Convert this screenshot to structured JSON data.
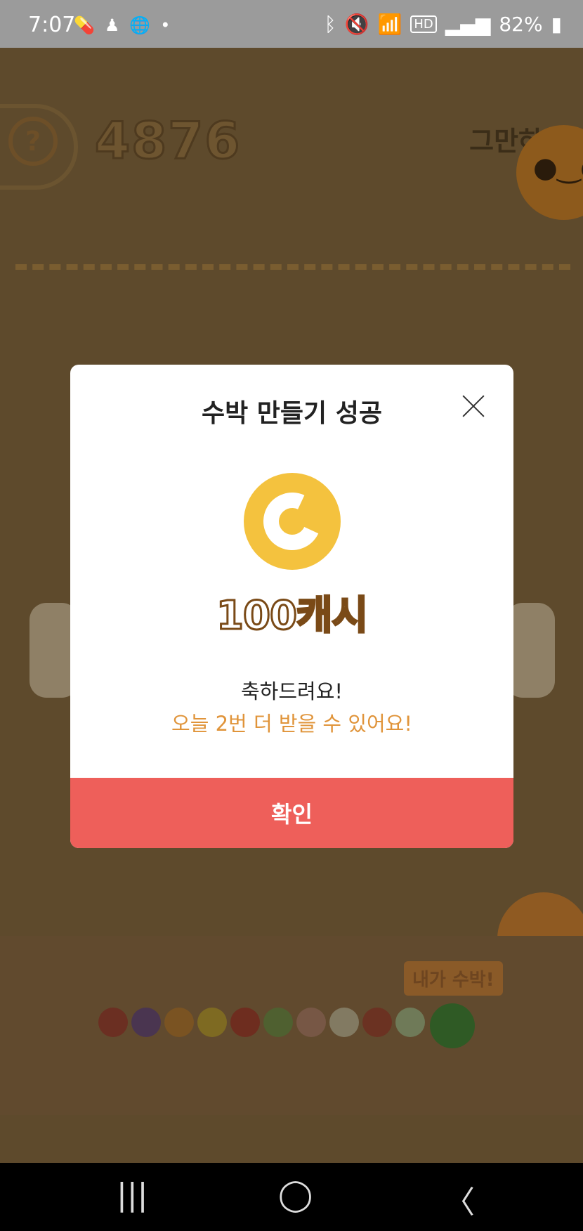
{
  "status_bar": {
    "time": "7:07",
    "battery": "82%",
    "left_icons": [
      "pill-icon",
      "person-icon",
      "globe-icon",
      "dot-icon"
    ],
    "right_icons": [
      "bluetooth-icon",
      "mute-icon",
      "wifi-icon",
      "hd-icon",
      "signal-icon",
      "battery-icon"
    ]
  },
  "game": {
    "help_label": "?",
    "score": "4876",
    "stop_label": "그만하기",
    "tag_label": "내가 수박!"
  },
  "modal": {
    "title": "수박 만들기 성공",
    "reward": "100캐시",
    "congrats": "축하드려요!",
    "remaining": "오늘 2번 더 받을 수 있어요!",
    "confirm_label": "확인",
    "coin_letter": "C",
    "coin_color": "#f4c23e",
    "accent_color": "#ee5f5a"
  },
  "fruit_colors": [
    "#6b2f22",
    "#4a3550",
    "#7a5322",
    "#7e6a22",
    "#6e2d1f",
    "#4f6030",
    "#775745",
    "#827a62",
    "#6b3222",
    "#6f7a58",
    "#2f5a25"
  ],
  "navbar": {
    "recent": "|||",
    "home": "◯",
    "back": "〈"
  }
}
